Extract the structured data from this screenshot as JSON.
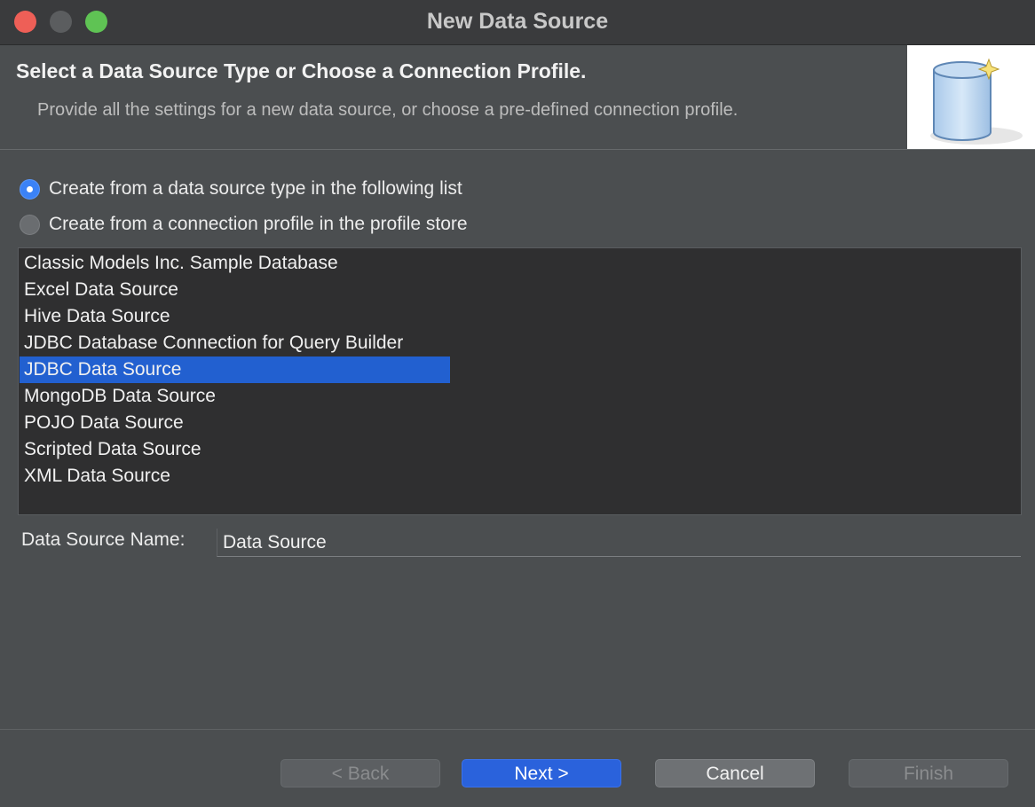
{
  "window": {
    "title": "New Data Source"
  },
  "header": {
    "title": "Select a Data Source Type or Choose a Connection Profile.",
    "description": "Provide all the settings for a new data source, or choose a pre-defined connection profile.",
    "image_icon": "database-cylinder-icon"
  },
  "options": {
    "from_type_label": "Create from a data source type in the following list",
    "from_type_selected": true,
    "from_profile_label": "Create from a connection profile in the profile store",
    "from_profile_selected": false
  },
  "data_source_types": [
    {
      "label": "Classic Models Inc. Sample Database",
      "selected": false
    },
    {
      "label": "Excel Data Source",
      "selected": false
    },
    {
      "label": "Hive Data Source",
      "selected": false
    },
    {
      "label": "JDBC Database Connection for Query Builder",
      "selected": false
    },
    {
      "label": "JDBC Data Source",
      "selected": true
    },
    {
      "label": "MongoDB Data Source",
      "selected": false
    },
    {
      "label": "POJO Data Source",
      "selected": false
    },
    {
      "label": "Scripted Data Source",
      "selected": false
    },
    {
      "label": "XML Data Source",
      "selected": false
    }
  ],
  "name_field": {
    "label": "Data Source Name:",
    "value": "Data Source"
  },
  "buttons": {
    "back": "< Back",
    "next": "Next >",
    "cancel": "Cancel",
    "finish": "Finish"
  },
  "colors": {
    "accent": "#2a62dc",
    "selection": "#2260d0",
    "close": "#ee5f57",
    "maximize": "#5fc354"
  }
}
